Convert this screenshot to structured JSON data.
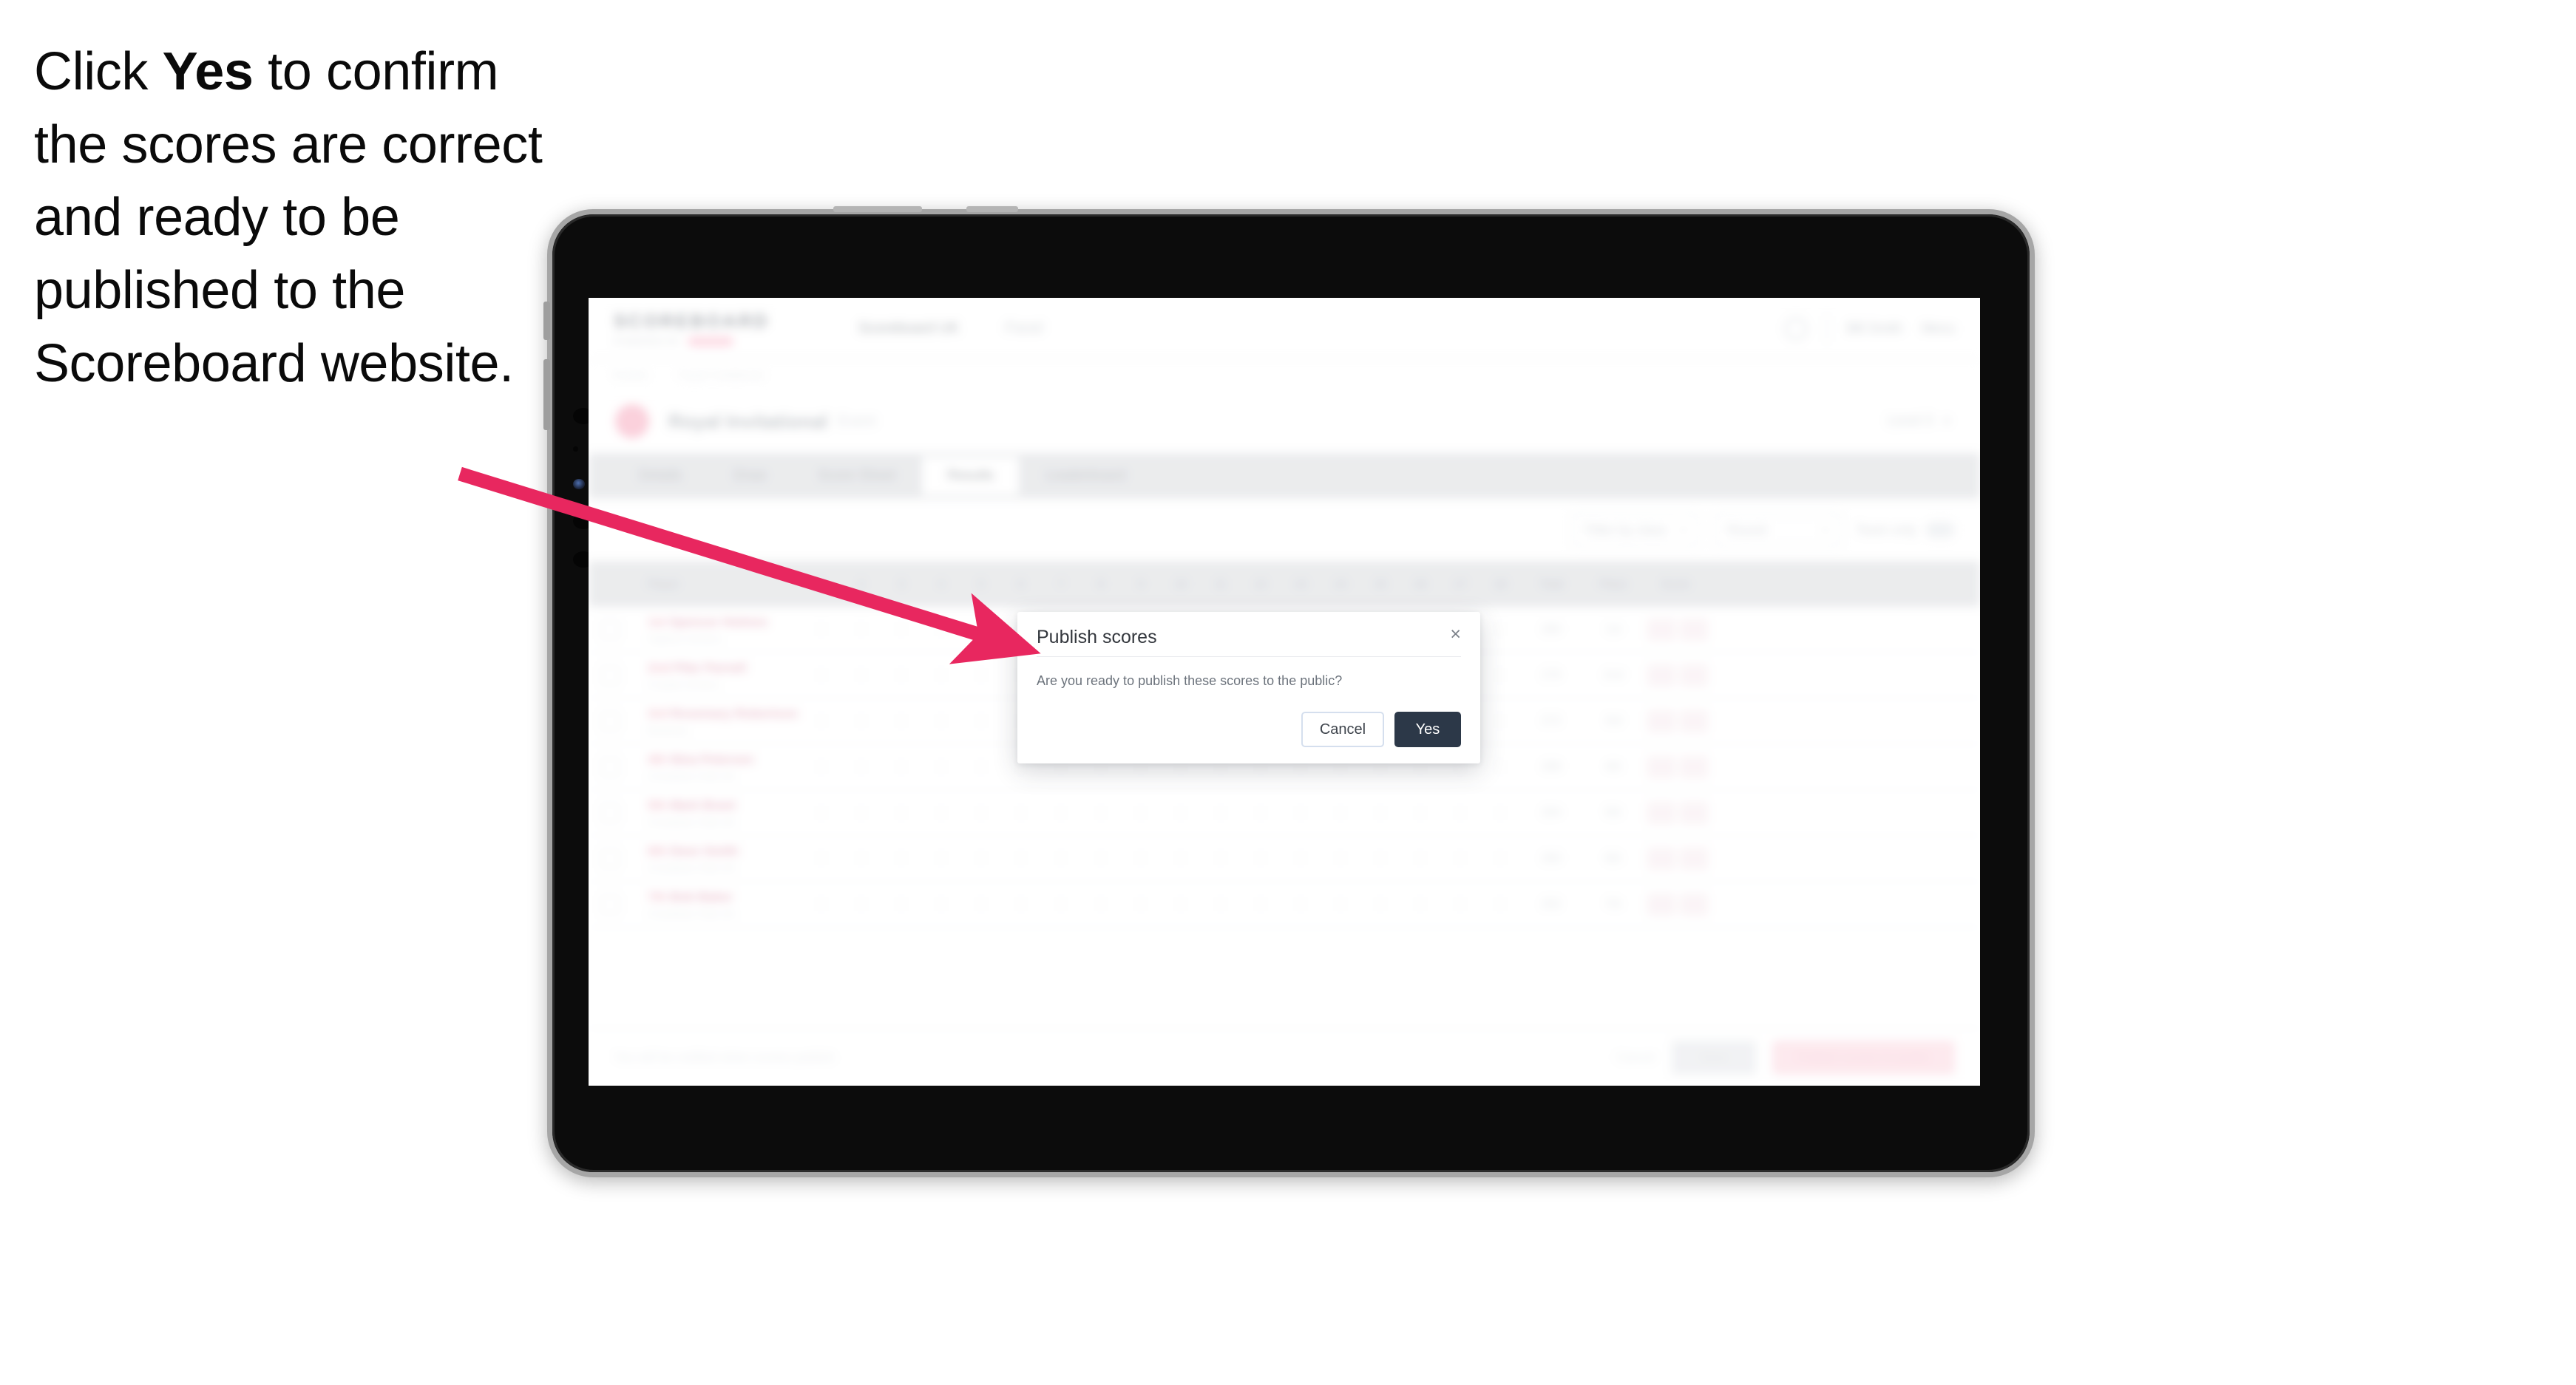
{
  "caption": {
    "before": "Click ",
    "bold": "Yes",
    "after": " to confirm the scores are correct and ready to be published to the Scoreboard website."
  },
  "colors": {
    "arrow": "#E8275F",
    "yes_button_bg": "#2C3848",
    "accent_pink": "#F4809F",
    "device_bezel": "#A6A6A6",
    "device_body": "#0C0C0C"
  },
  "device": {
    "type": "tablet"
  },
  "modal": {
    "title": "Publish scores",
    "close_label": "×",
    "body": "Are you ready to publish these scores to the public?",
    "cancel_label": "Cancel",
    "confirm_label": "Yes"
  },
  "app": {
    "brand": {
      "word": "SCOREBOARD",
      "sub_text": "POWERED BY"
    },
    "topnav": [
      {
        "label": "Scoreboard UK"
      },
      {
        "label": "Panel"
      }
    ],
    "top_right": [
      {
        "label": "Bill Smith"
      },
      {
        "label": "Menu"
      }
    ],
    "breadcrumb": [
      {
        "label": "Events"
      },
      {
        "label": "Royal Invitational"
      }
    ],
    "event": {
      "title": "Royal Invitational",
      "subtitle": "Event",
      "right_label": "Level 3"
    },
    "tabs": [
      {
        "label": "Details",
        "active": false
      },
      {
        "label": "Draw",
        "active": false
      },
      {
        "label": "Score Sheet",
        "active": false
      },
      {
        "label": "Results",
        "active": true
      },
      {
        "label": "Leaderboard",
        "active": false
      }
    ],
    "filters": {
      "select_1": "Filter by class",
      "select_2": "Round",
      "toggle_label": "Team only"
    },
    "table": {
      "headers": [
        "",
        "Player",
        "1",
        "2",
        "3",
        "4",
        "5",
        "6",
        "7",
        "8",
        "9",
        "10",
        "11",
        "12",
        "13",
        "14",
        "15",
        "16",
        "17",
        "18",
        "Total",
        "Place",
        "Score"
      ],
      "rows": [
        {
          "rank": "1st",
          "name": "Spencer Holmes",
          "club": "Highton Archers",
          "scores": [
            "9",
            "9",
            "8",
            "9",
            "9",
            "9",
            "8",
            "9",
            "9",
            "10",
            "9",
            "9",
            "8",
            "9",
            "9",
            "10",
            "9",
            "9"
          ],
          "total": "280",
          "place": "1st",
          "score_a": "280",
          "score_b": "120"
        },
        {
          "rank": "2nd",
          "name": "Pilar Parnell",
          "club": "Croyde Archers",
          "scores": [
            "9",
            "8",
            "9",
            "8",
            "9",
            "9",
            "9",
            "8",
            "9",
            "9",
            "9",
            "8",
            "9",
            "9",
            "8",
            "9",
            "9",
            "9"
          ],
          "total": "276",
          "place": "2nd",
          "score_a": "276",
          "score_b": "118"
        },
        {
          "rank": "3rd",
          "name": "Rosemary Robertson",
          "club": "Bowmen",
          "scores": [
            "8",
            "9",
            "8",
            "9",
            "8",
            "9",
            "8",
            "9",
            "8",
            "9",
            "8",
            "9",
            "8",
            "9",
            "8",
            "9",
            "8",
            "9"
          ],
          "total": "272",
          "place": "3rd",
          "score_a": "272",
          "score_b": "115"
        },
        {
          "rank": "4th",
          "name": "Nina Petersen",
          "club": "Crossbow Club UK",
          "scores": [
            "8",
            "8",
            "9",
            "8",
            "9",
            "8",
            "9",
            "8",
            "10",
            "8",
            "9",
            "8",
            "9",
            "8",
            "9",
            "8",
            "9",
            "8"
          ],
          "total": "268",
          "place": "4th",
          "score_a": "268",
          "score_b": "112"
        },
        {
          "rank": "5th",
          "name": "Mark Brant",
          "club": "Crossbow Club UK",
          "scores": [
            "8",
            "8",
            "8",
            "9",
            "8",
            "8",
            "9",
            "8",
            "9",
            "8",
            "8",
            "9",
            "8",
            "8",
            "9",
            "8",
            "8",
            "9"
          ],
          "total": "264",
          "place": "5th",
          "score_a": "264",
          "score_b": "110"
        },
        {
          "rank": "6th",
          "name": "Dave Smith",
          "club": "Crossbow Club UK",
          "scores": [
            "8",
            "7",
            "8",
            "8",
            "8",
            "8",
            "8",
            "9",
            "8",
            "8",
            "8",
            "8",
            "8",
            "8",
            "8",
            "8",
            "8",
            "8"
          ],
          "total": "260",
          "place": "6th",
          "score_a": "260",
          "score_b": "108"
        },
        {
          "rank": "7th",
          "name": "Bob Baker",
          "club": "Crossbow Club UK",
          "scores": [
            "7",
            "8",
            "7",
            "8",
            "8",
            "7",
            "8",
            "8",
            "8",
            "7",
            "8",
            "8",
            "7",
            "8",
            "8",
            "7",
            "8",
            "8"
          ],
          "total": "252",
          "place": "7th",
          "score_a": "252",
          "score_b": "104"
        }
      ]
    },
    "footer": {
      "note": "You will be notified when scores publish",
      "link_label": "Cancel",
      "secondary_label": "Save",
      "primary_label": "Publish scores to public"
    }
  }
}
